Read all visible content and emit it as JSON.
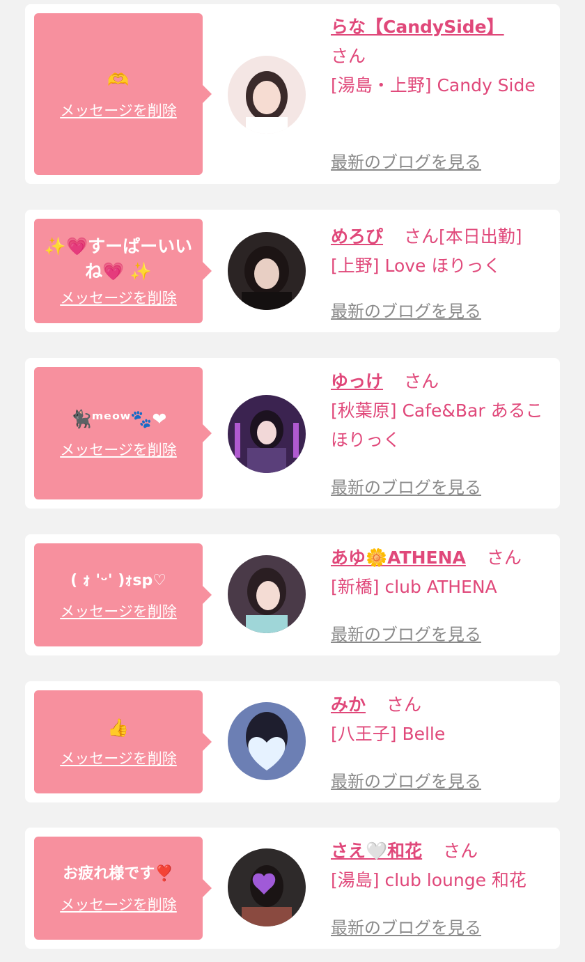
{
  "delete_label": "メッセージを削除",
  "blog_label": "最新のブログを見る",
  "san_suffix": "さん",
  "cards": [
    {
      "message": "🫶",
      "name": "らな【CandySide】",
      "status": "",
      "shop": "[湯島・上野] Candy Side"
    },
    {
      "message": "✨💗すーぱーいいね💗 ✨",
      "name": "めろぴ",
      "status": "[本日出勤]",
      "shop": "[上野] Love ほりっく"
    },
    {
      "message": "🐈‍⬛ᵐᵉᵒʷ🐾❤",
      "name": "ゆっけ",
      "status": "",
      "shop": "[秋葉原] Cafe&Bar あるこほりっく"
    },
    {
      "message": "( ｫ 'ᵕ' )ｫsp♡",
      "name": "あゆ🌼ATHENA",
      "status": "",
      "shop": "[新橋] club ATHENA"
    },
    {
      "message": "👍",
      "name": "みか",
      "status": "",
      "shop": "[八王子] Belle"
    },
    {
      "message": "お疲れ様です❣️",
      "name": "さえ🤍和花",
      "status": "",
      "shop": "[湯島] club lounge 和花"
    }
  ],
  "colors": {
    "bubble": "#f7909e",
    "accent": "#e0487a",
    "muted": "#8a8a8a",
    "background": "#f2f2f2"
  }
}
